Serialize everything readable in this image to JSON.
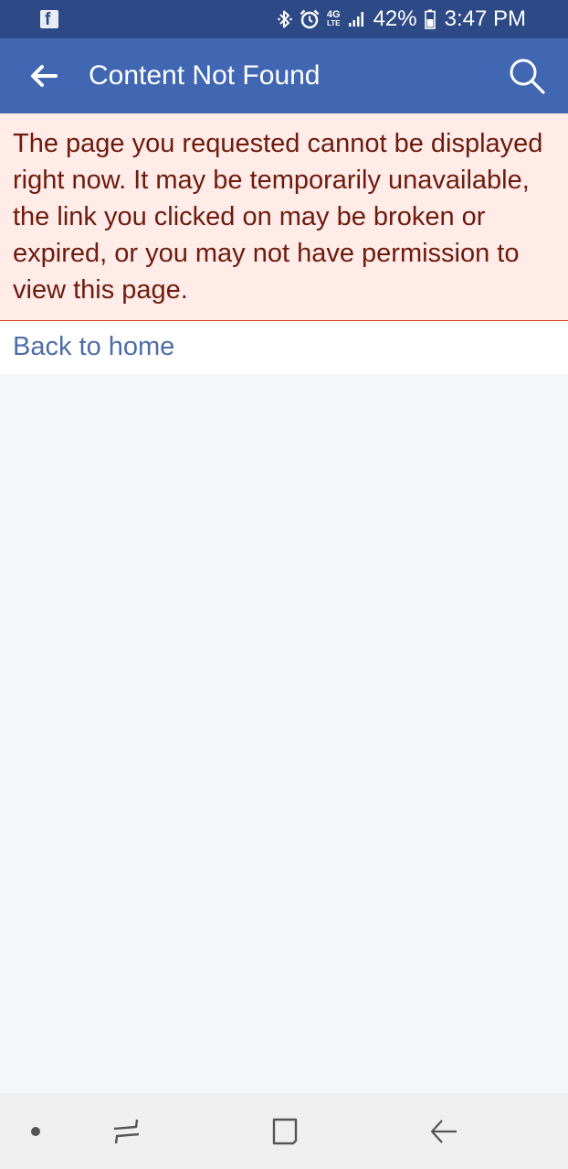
{
  "status_bar": {
    "app_notification_icon": "facebook-icon",
    "bluetooth_icon": "bluetooth-icon",
    "alarm_icon": "alarm-icon",
    "network_top": "4G",
    "network_bottom": "LTE",
    "signal_icon": "signal-icon",
    "battery_percent": "42%",
    "battery_icon": "battery-icon",
    "time": "3:47 PM"
  },
  "app_bar": {
    "back_icon": "arrow-left-icon",
    "title": "Content Not Found",
    "search_icon": "search-icon"
  },
  "error": {
    "message": "The page you requested cannot be displayed right now. It may be temporarily unavailable, the link you clicked on may be broken or expired, or you may not have permission to view this page."
  },
  "links": {
    "back_to_home": "Back to home"
  },
  "nav_bar": {
    "buttons": [
      "dot-icon",
      "recent-apps-icon",
      "home-icon",
      "back-icon"
    ]
  },
  "colors": {
    "status_bar": "#2d4a86",
    "app_bar": "#4267b2",
    "error_background": "#ffebe8",
    "error_border": "#dd3c10",
    "error_text": "#6e1b0d",
    "link": "#4d6da8",
    "page_background": "#f5f6f8",
    "nav_bar": "#efefef"
  }
}
